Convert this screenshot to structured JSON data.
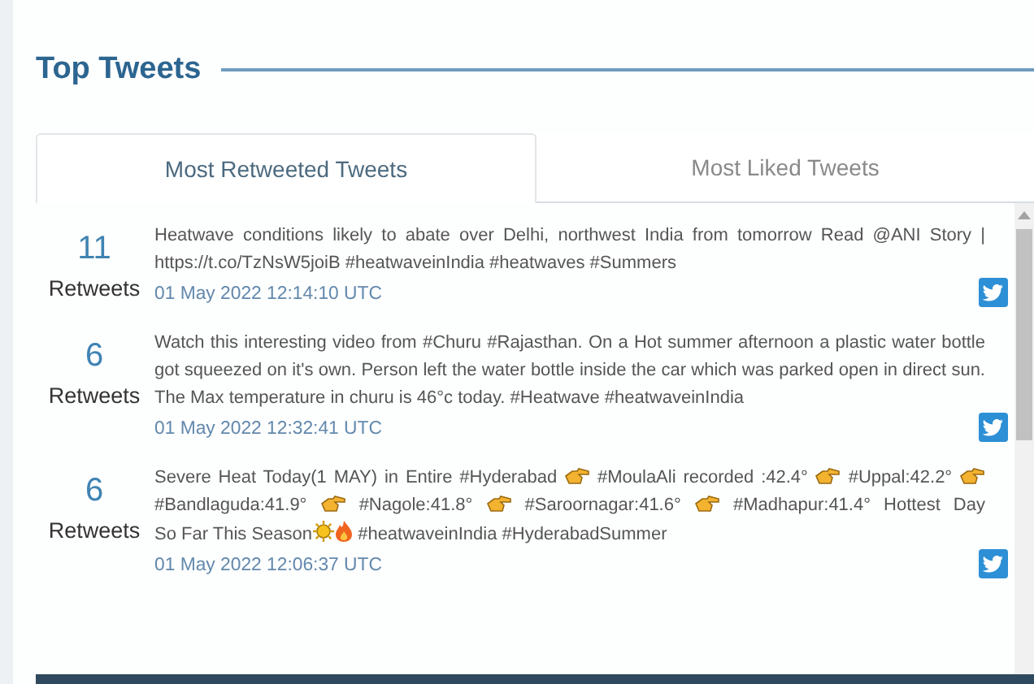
{
  "title": "Top Tweets",
  "tabs": [
    {
      "label": "Most Retweeted Tweets",
      "selected": true
    },
    {
      "label": "Most Liked Tweets",
      "selected": false
    }
  ],
  "tweets": [
    {
      "count": "11",
      "count_label": "Retweets",
      "segments": [
        {
          "kind": "text",
          "text": "Heatwave conditions likely to abate over Delhi, northwest India from tomorrow Read @ANI Story | https://t.co/TzNsW5joiB #heatwaveinIndia #heatwaves #Summers"
        }
      ],
      "date": "01 May 2022 12:14:10 UTC"
    },
    {
      "count": "6",
      "count_label": "Retweets",
      "segments": [
        {
          "kind": "text",
          "text": "Watch this interesting video from #Churu #Rajasthan. On a Hot summer afternoon a plastic water bottle got squeezed on it's own. Person left the water bottle inside the car which was parked open in direct sun. The Max temperature in churu is 46°c today. #Heatwave #heatwaveinIndia"
        }
      ],
      "date": "01 May 2022 12:32:41 UTC"
    },
    {
      "count": "6",
      "count_label": "Retweets",
      "segments": [
        {
          "kind": "text",
          "text": "Severe Heat Today(1 MAY) in Entire #Hyderabad"
        },
        {
          "kind": "hand"
        },
        {
          "kind": "text",
          "text": "#MoulaAli recorded :42.4°"
        },
        {
          "kind": "hand"
        },
        {
          "kind": "text",
          "text": "#Uppal:42.2°"
        },
        {
          "kind": "hand"
        },
        {
          "kind": "text",
          "text": "#Bandlaguda:41.9°"
        },
        {
          "kind": "hand"
        },
        {
          "kind": "text",
          "text": "#Nagole:41.8°"
        },
        {
          "kind": "hand"
        },
        {
          "kind": "text",
          "text": "#Saroornagar:41.6°"
        },
        {
          "kind": "hand"
        },
        {
          "kind": "text",
          "text": "#Madhapur:41.4° Hottest Day"
        },
        {
          "kind": "text",
          "text": "So Far This Season"
        },
        {
          "kind": "sun"
        },
        {
          "kind": "fire"
        },
        {
          "kind": "text",
          "text": "#heatwaveinIndia #HyderabadSummer"
        }
      ],
      "date": "01 May 2022 12:06:37 UTC"
    }
  ]
}
